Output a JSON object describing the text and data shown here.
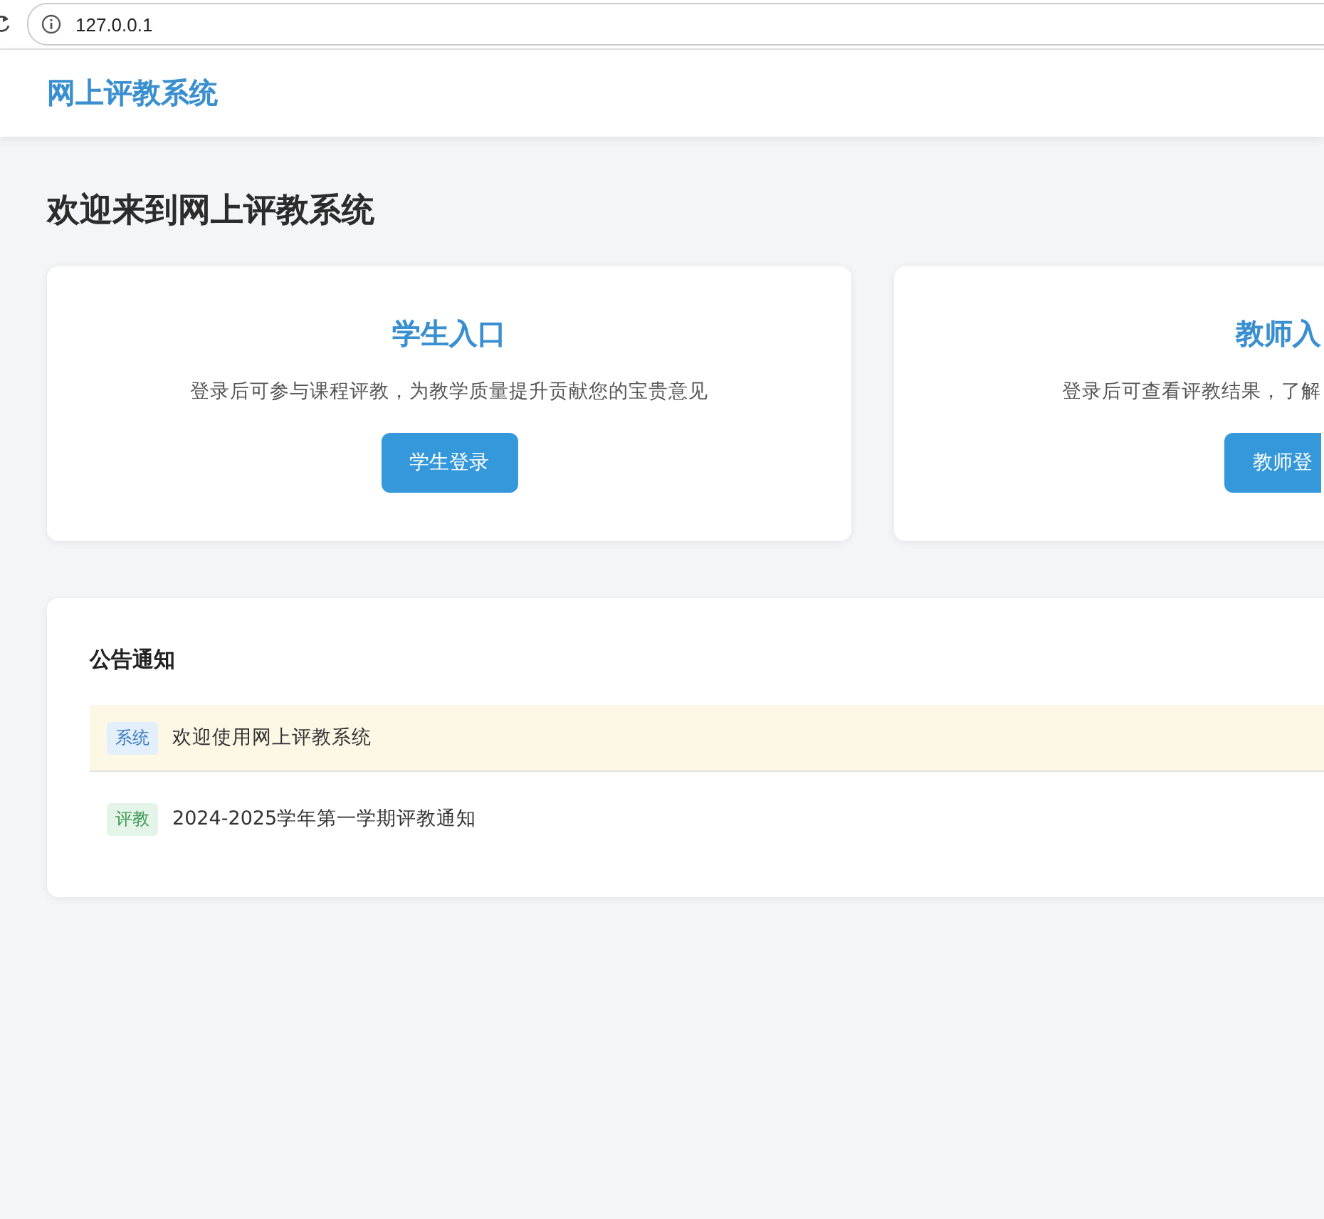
{
  "browser": {
    "address": "127.0.0.1"
  },
  "navbar": {
    "title": "网上评教系统"
  },
  "heading": "欢迎来到网上评教系统",
  "entries": [
    {
      "title": "学生入口",
      "description": "登录后可参与课程评教，为教学质量提升贡献您的宝贵意见",
      "button": "学生登录"
    },
    {
      "title": "教师入",
      "description": "登录后可查看评教结果，了解",
      "button": "教师登"
    }
  ],
  "notices": {
    "title": "公告通知",
    "items": [
      {
        "kind": "system",
        "tag": "系统",
        "text": "欢迎使用网上评教系统",
        "selected": true
      },
      {
        "kind": "evaluation",
        "tag": "评教",
        "text": "2024-2025学年第一学期评教通知",
        "selected": false
      }
    ]
  }
}
